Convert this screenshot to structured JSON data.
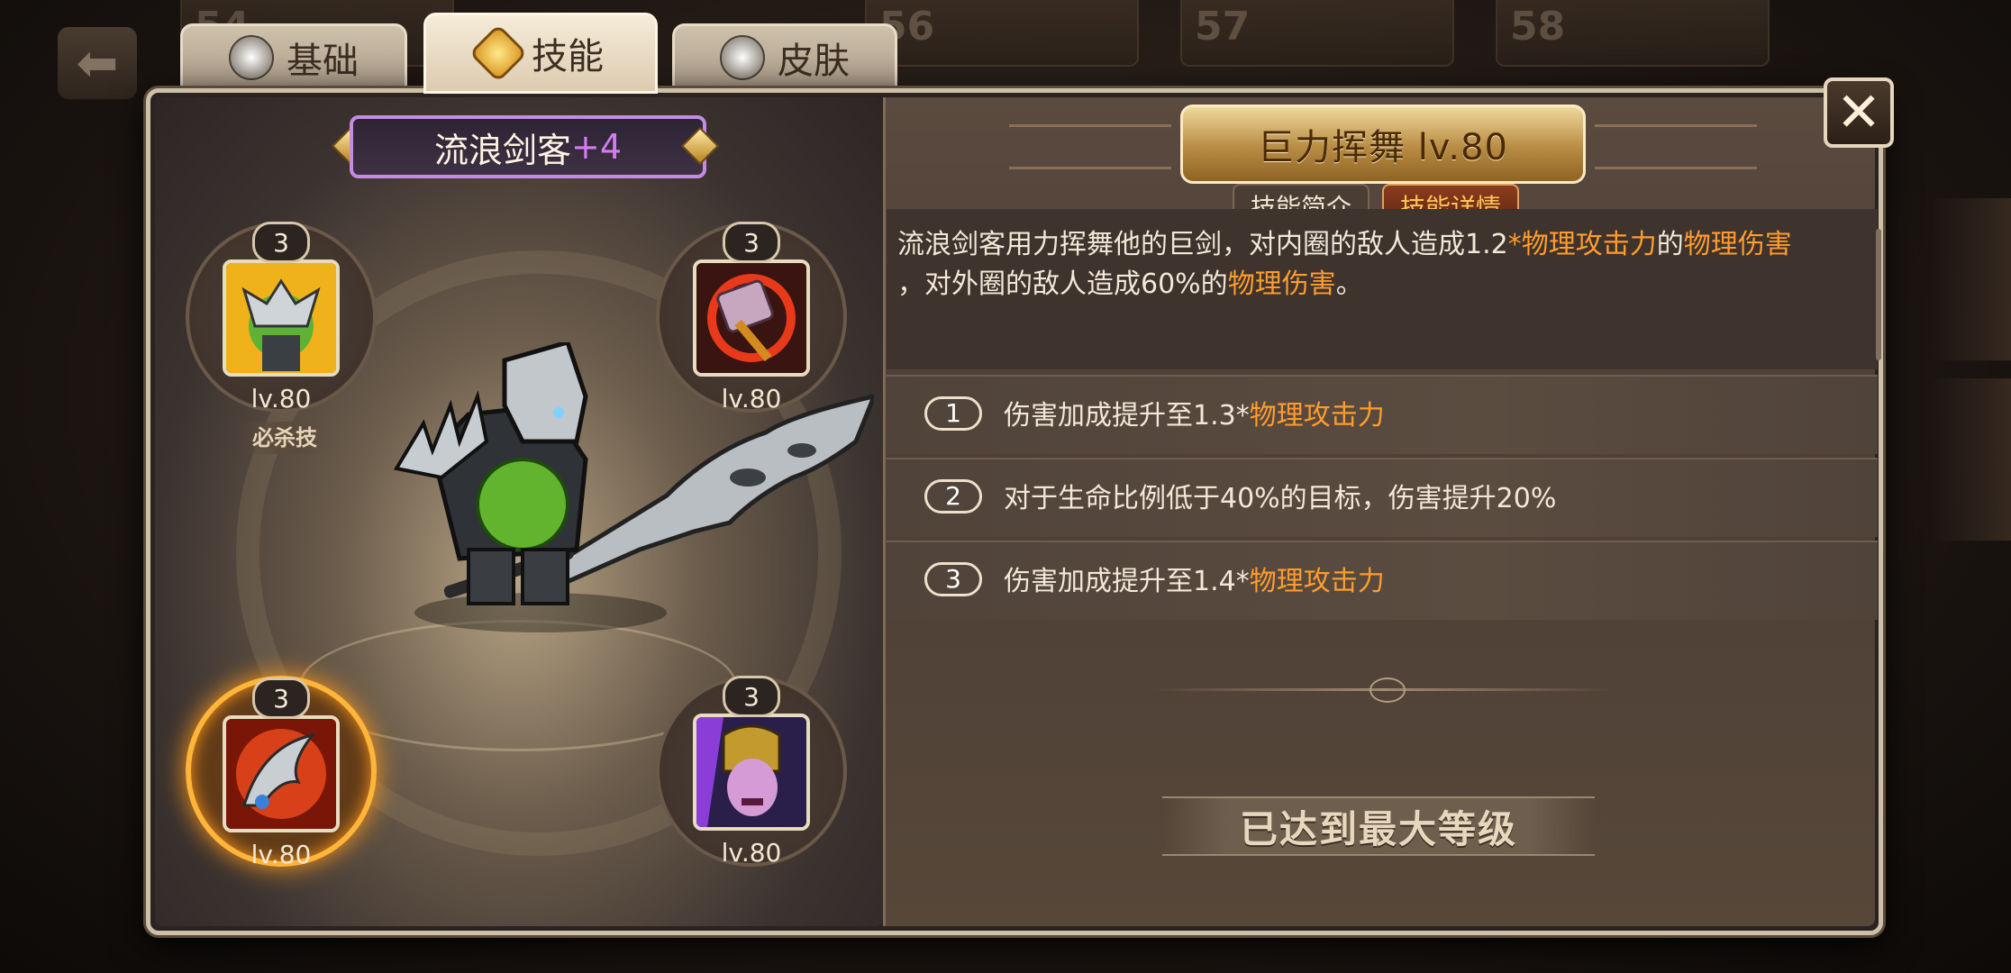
{
  "tabs": [
    {
      "label": "基础",
      "icon": "helmet-icon"
    },
    {
      "label": "技能",
      "icon": "skill-emblem-icon"
    },
    {
      "label": "皮肤",
      "icon": "mask-icon"
    }
  ],
  "background": {
    "slot_numbers": [
      "54",
      "56",
      "57",
      "58"
    ]
  },
  "hero": {
    "name": "流浪剑客",
    "plus": "+4"
  },
  "skills": [
    {
      "badge": "3",
      "level": "lv.80",
      "tag": "必杀技",
      "icon": "green-ogre-knight-icon"
    },
    {
      "badge": "3",
      "level": "lv.80",
      "icon": "hammer-icon"
    },
    {
      "badge": "3",
      "level": "lv.80",
      "icon": "flaming-blade-icon",
      "selected": true
    },
    {
      "badge": "3",
      "level": "lv.80",
      "icon": "purple-warrior-icon"
    }
  ],
  "detail": {
    "title": "巨力挥舞 lv.80",
    "subtab_intro": "技能简介",
    "subtab_detail": "技能详情",
    "desc_1": "流浪剑客用力挥舞他的巨剑，对内圈的敌人造成1.2",
    "desc_2": "*物理攻击力",
    "desc_3": "的",
    "desc_4": "物理伤害",
    "desc_5": "，对外圈的敌人造成60%的",
    "desc_6": "物理伤害",
    "desc_7": "。",
    "upgrades": [
      {
        "num": "1",
        "text": "伤害加成提升至1.3*",
        "highlight": "物理攻击力"
      },
      {
        "num": "2",
        "text": "对于生命比例低于40%的目标，伤害提升20%",
        "highlight": ""
      },
      {
        "num": "3",
        "text": "伤害加成提升至1.4*",
        "highlight": "物理攻击力"
      }
    ],
    "max_level_label": "已达到最大等级"
  },
  "close_label": "✕",
  "colors": {
    "highlight": "#ff9c2e",
    "name_border": "#c38ce0",
    "selected_glow": "#ffb53a"
  }
}
